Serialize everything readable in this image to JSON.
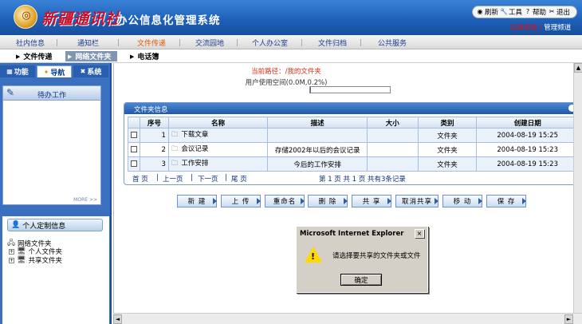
{
  "header": {
    "logo_calligraphy": "新疆通讯社",
    "system_title": "办公信息化管理系统",
    "tools": [
      {
        "label": "刷新",
        "icon": "refresh-icon"
      },
      {
        "label": "工具",
        "icon": "tools-icon"
      },
      {
        "label": "帮助",
        "icon": "help-icon"
      },
      {
        "label": "退出",
        "icon": "exit-icon"
      }
    ],
    "app_channel": "应用频道",
    "mgmt_channel": "管理频道",
    "channel_sep": "|"
  },
  "main_nav": [
    "社内信息",
    "通知栏",
    "文件传递",
    "交流园地",
    "个人办公室",
    "文件归档",
    "公共服务"
  ],
  "main_nav_active": "文件传递",
  "sub_nav": [
    "文件传递",
    "网络文件夹",
    "电话簿"
  ],
  "sub_nav_active": "网络文件夹",
  "left_panel": {
    "tabs": [
      {
        "label": "功能",
        "icon": "function-icon"
      },
      {
        "label": "导航",
        "icon": "navigation-icon"
      },
      {
        "label": "系统",
        "icon": "system-icon"
      }
    ],
    "active_tab": "导航",
    "todo_title": "待办工作",
    "more_label": "MORE >>",
    "custom_title": "个人定制信息",
    "tree": {
      "root": "网络文件夹",
      "children": [
        "个人文件夹",
        "共享文件夹"
      ]
    }
  },
  "content": {
    "path_label": "当前路径：/我的文件夹",
    "usage_label": "用户使用空间(0.0M,0.2%)",
    "usage_fraction": 0.002,
    "folder_panel_title": "文件夹信息",
    "columns": [
      "序号",
      "名称",
      "描述",
      "大小",
      "类别",
      "创建日期"
    ],
    "rows": [
      {
        "index": "1",
        "name": "下载文章",
        "desc": "",
        "size": "",
        "type": "文件夹",
        "date": "2004-08-19 15:25"
      },
      {
        "index": "2",
        "name": "会议记录",
        "desc": "存储2002年以后的会议记录",
        "size": "",
        "type": "文件夹",
        "date": "2004-08-19 15:23"
      },
      {
        "index": "3",
        "name": "工作安排",
        "desc": "今后的工作安排",
        "size": "",
        "type": "文件夹",
        "date": "2004-08-19 15:23"
      }
    ],
    "pager": {
      "first": "首 页",
      "prev": "上一页",
      "next": "下一页",
      "last": "尾 页",
      "sep": "|",
      "summary": "第 1 页 共 1 页  共有3条记录"
    },
    "actions": [
      "新 建",
      "上 传",
      "重命名",
      "删 除",
      "共 享",
      "取消共享",
      "移 动",
      "保 存"
    ]
  },
  "dialog": {
    "title": "Microsoft Internet Explorer",
    "close": "×",
    "message": "请选择要共享的文件夹或文件",
    "ok_label": "确定",
    "icon": "warning-icon"
  },
  "scrollbar": {
    "up": "▲",
    "down": "▼",
    "left": "◄",
    "right": "►"
  }
}
